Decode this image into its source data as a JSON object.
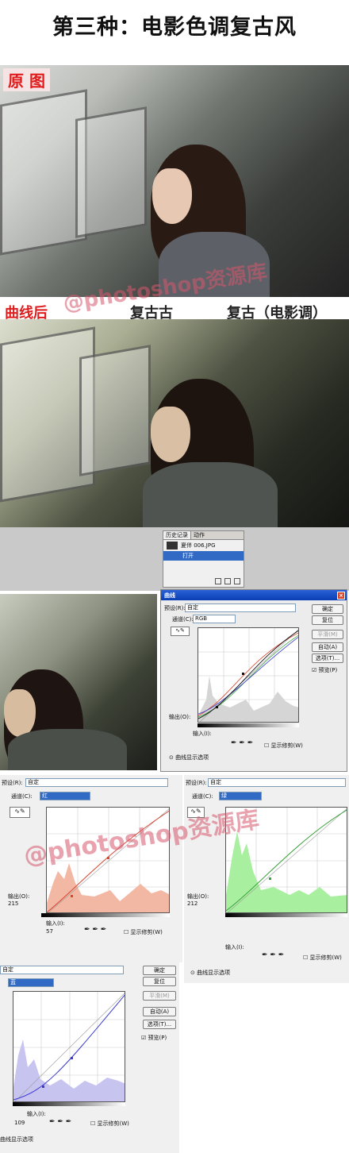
{
  "page": {
    "title": "第三种：电影色调复古风"
  },
  "labels": {
    "original": "原 图",
    "after_curves": "曲线后",
    "retro1": "复古古",
    "retro2": "复古（电影调）",
    "watermark": "@photoshop资源库",
    "watermark2": "@photoshop资源库"
  },
  "history_panel": {
    "tabs": [
      "历史记录",
      "动作"
    ],
    "file": "夏伴 006.JPG",
    "step": "打开"
  },
  "curves_dialog": {
    "title": "曲线",
    "preset_label": "预设(R):",
    "preset_value": "自定",
    "channel_label": "通道(C):",
    "channel_value": "RGB",
    "buttons": [
      "确定",
      "复位",
      "平滑(M)",
      "自动(A)",
      "选项(T)..."
    ],
    "preview": "预览(P)",
    "output": "输出(O):",
    "input": "输入(I):",
    "clip": "显示修剪(W)",
    "options": "曲线显示选项"
  },
  "red_panel": {
    "preset_label": "预设(R):",
    "preset_value": "自定",
    "channel_label": "通道(C):",
    "channel_value": "红",
    "output_label": "输出(O):",
    "output_value": "215",
    "input_label": "输入(I):",
    "input_value": "57",
    "clip": "显示修剪(W)"
  },
  "green_panel": {
    "preset_label": "预设(R):",
    "preset_value": "自定",
    "channel_label": "通道(C):",
    "channel_value": "绿",
    "output_label": "输出(O):",
    "output_value": "212",
    "input_label": "输入(I):",
    "clip": "显示修剪(W)",
    "options": "曲线显示选项"
  },
  "blue_panel": {
    "preset_value": "自定",
    "channel_value": "蓝",
    "input_label": "输入(I):",
    "input_value": "109",
    "buttons": [
      "确定",
      "复位",
      "平滑(M)",
      "自动(A)",
      "选项(T)..."
    ],
    "preview": "预览(P)",
    "clip": "显示修剪(W)",
    "options": "曲线显示选项"
  },
  "colors": {
    "red_curve": "#d9452f",
    "green_curve": "#3aa13a",
    "blue_curve": "#3a3ad0",
    "accent": "#e01b1b"
  }
}
